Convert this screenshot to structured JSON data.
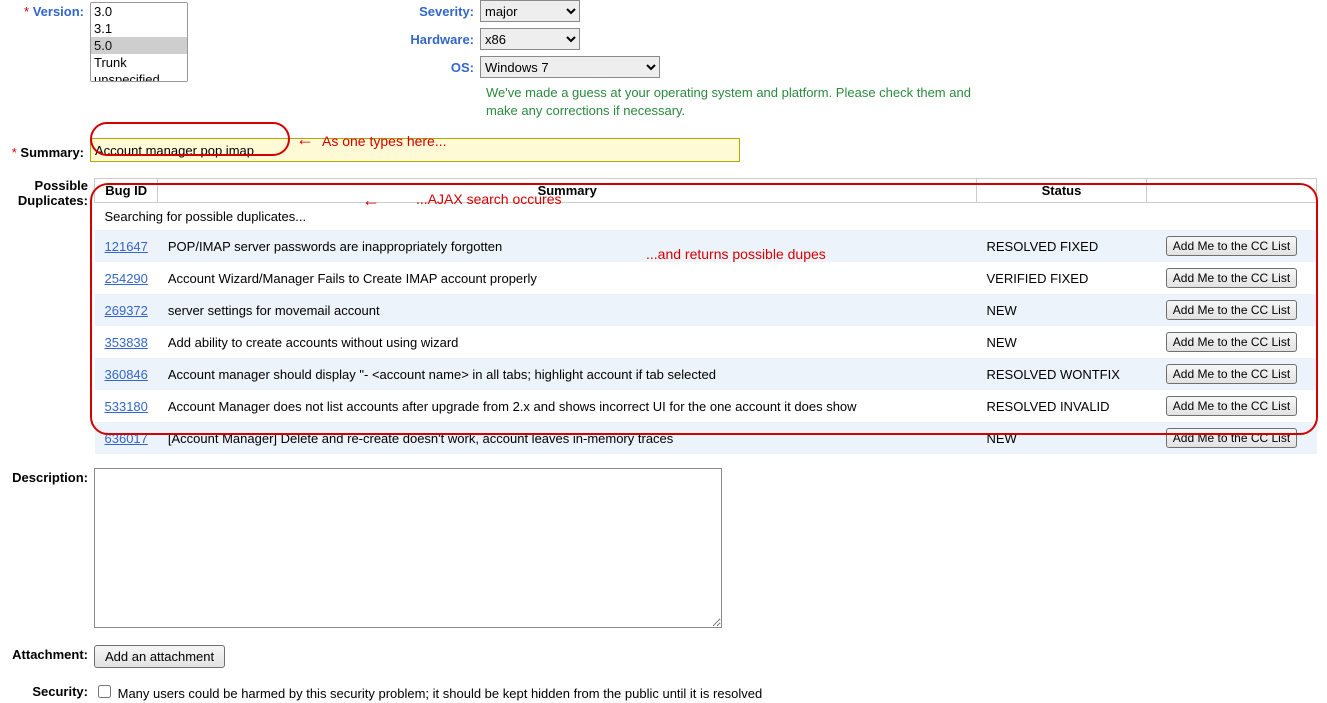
{
  "labels": {
    "version": "Version:",
    "severity": "Severity:",
    "hardware": "Hardware:",
    "os": "OS:",
    "summary": "Summary:",
    "possible_duplicates": "Possible\nDuplicates:",
    "description": "Description:",
    "attachment": "Attachment:",
    "security": "Security:"
  },
  "version": {
    "options": [
      "3.0",
      "3.1",
      "5.0",
      "Trunk",
      "unspecified"
    ],
    "selected": "5.0"
  },
  "severity": {
    "selected": "major"
  },
  "hardware": {
    "selected": "x86"
  },
  "os": {
    "selected": "Windows 7"
  },
  "os_note": "We've made a guess at your operating system and platform. Please check them and make any corrections if necessary.",
  "summary_value": "Account manager pop imap",
  "dup_headers": {
    "bug_id": "Bug ID",
    "summary": "Summary",
    "status": "Status"
  },
  "searching_text": "Searching for possible duplicates...",
  "cc_button_label": "Add Me to the CC List",
  "duplicates": [
    {
      "id": "121647",
      "summary": "POP/IMAP server passwords are inappropriately forgotten",
      "status": "RESOLVED FIXED"
    },
    {
      "id": "254290",
      "summary": "Account Wizard/Manager Fails to Create IMAP account properly",
      "status": "VERIFIED FIXED"
    },
    {
      "id": "269372",
      "summary": "server settings for movemail account",
      "status": "NEW"
    },
    {
      "id": "353838",
      "summary": "Add ability to create accounts without using wizard",
      "status": "NEW"
    },
    {
      "id": "360846",
      "summary": "Account manager should display \"- <account name> in all tabs; highlight account if tab selected",
      "status": "RESOLVED WONTFIX"
    },
    {
      "id": "533180",
      "summary": "Account Manager does not list accounts after upgrade from 2.x and shows incorrect UI for the one account it does show",
      "status": "RESOLVED INVALID"
    },
    {
      "id": "636017",
      "summary": "[Account Manager] Delete and re-create doesn't work, account leaves in-memory traces",
      "status": "NEW"
    }
  ],
  "attachment_button": "Add an attachment",
  "security_text": "Many users could be harmed by this security problem; it should be kept hidden from the public until it is resolved",
  "annotations": {
    "a1": "As one types here...",
    "a2": "...AJAX search occures",
    "a3": "...and returns possible dupes"
  }
}
